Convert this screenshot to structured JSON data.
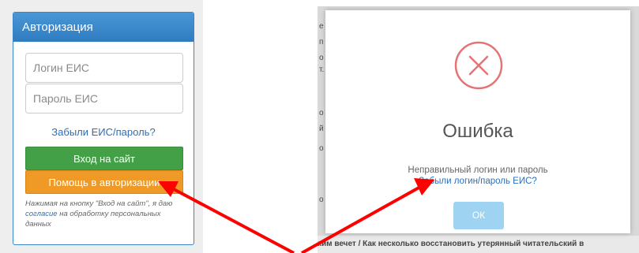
{
  "login_panel": {
    "title": "Авторизация",
    "login_placeholder": "Логин ЕИС",
    "password_placeholder": "Пароль ЕИС",
    "forgot_link": "Забыли ЕИС/пароль?",
    "login_button": "Вход на сайт",
    "help_button": "Помощь в авторизации",
    "disclaimer_prefix": "Нажимая на кнопку \"Вход на сайт\", я даю",
    "disclaimer_link": "согласие",
    "disclaimer_suffix": "на обработку персональных данных"
  },
  "error_modal": {
    "title": "Ошибка",
    "message": "Неправильный логин или пароль",
    "link": "Забыли логин/пароль ЕИС?",
    "ok_button": "ОК"
  },
  "background_page": {
    "bottom_text": "ким вечет / Как несколько восстановить утерянный читательский в"
  },
  "colors": {
    "header_blue": "#3a86c8",
    "login_green": "#43a047",
    "help_orange": "#ef9a26",
    "error_red": "#e57373",
    "ok_blue": "#9fd3f2",
    "arrow_red": "#ff0000"
  }
}
